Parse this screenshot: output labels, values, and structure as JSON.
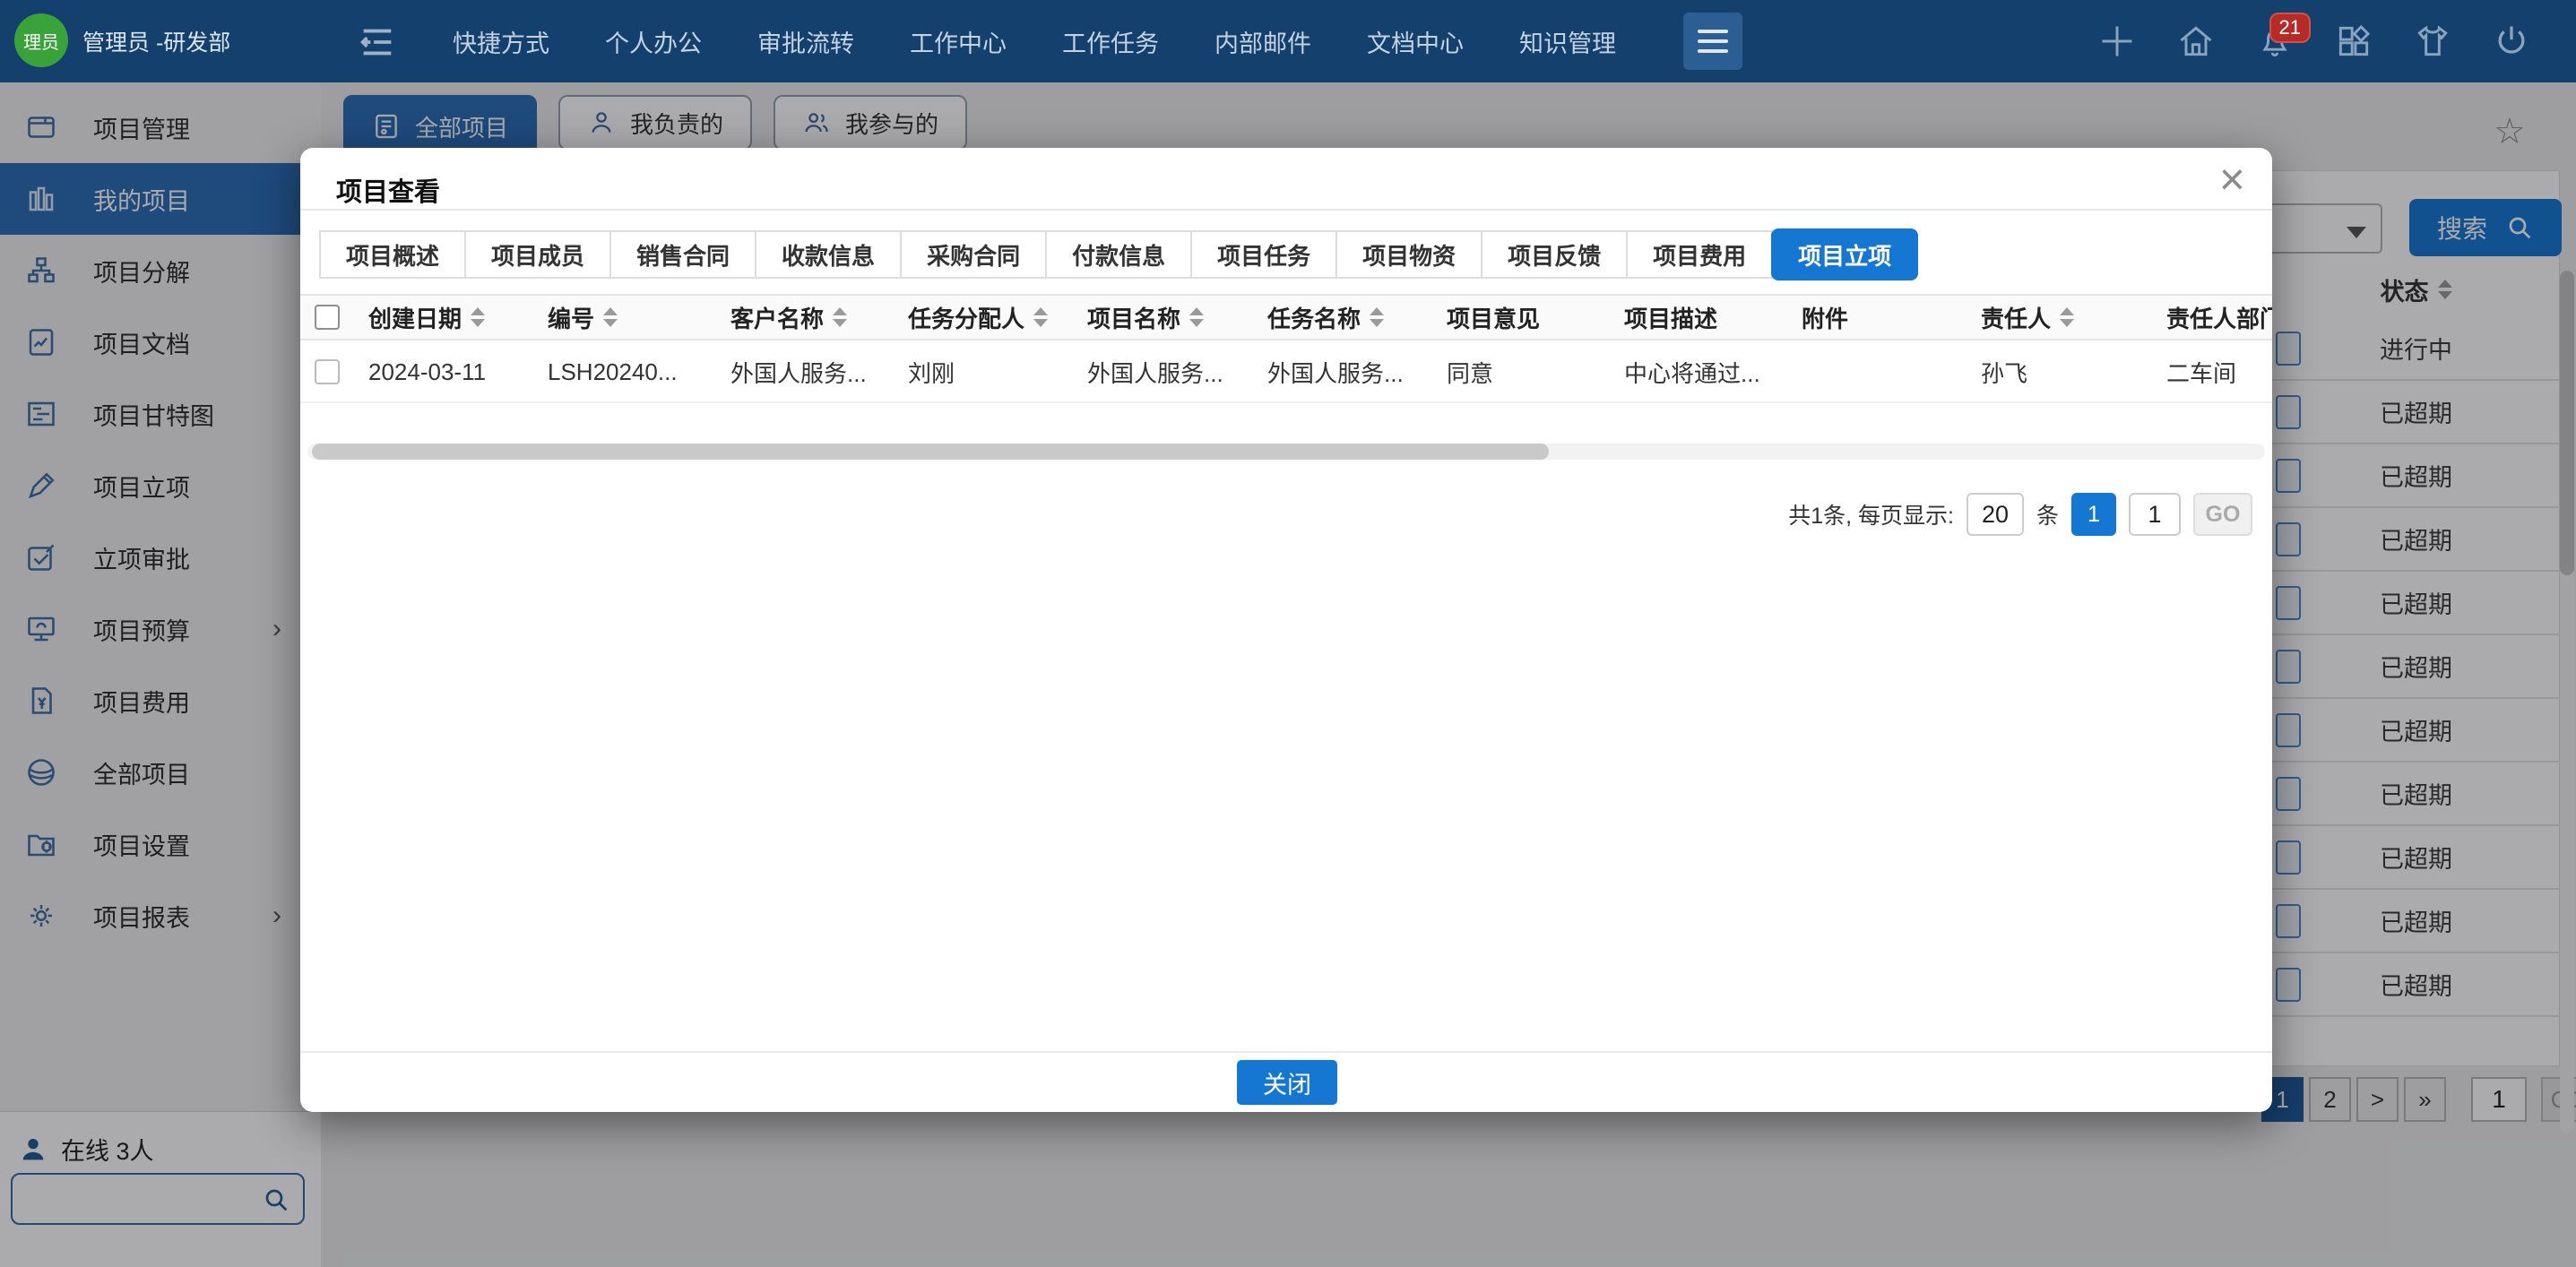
{
  "colors": {
    "accent": "#1677d2",
    "topbar": "#14406e",
    "active_nav": "#2a6cb5",
    "badge": "#b52b27",
    "avatar_green": "#3aa23a"
  },
  "topbar": {
    "user": {
      "avatar_text": "理员",
      "name": "管理员 -研发部"
    },
    "menu": [
      "快捷方式",
      "个人办公",
      "审批流转",
      "工作中心",
      "工作任务",
      "内部邮件",
      "文档中心",
      "知识管理"
    ],
    "notification_count": "21"
  },
  "sidebar": {
    "items": [
      {
        "label": "项目管理",
        "icon": "i-window",
        "active": false,
        "has_submenu": false
      },
      {
        "label": "我的项目",
        "icon": "i-myproj",
        "active": true,
        "has_submenu": false
      },
      {
        "label": "项目分解",
        "icon": "i-breakdown",
        "active": false,
        "has_submenu": false
      },
      {
        "label": "项目文档",
        "icon": "i-doc",
        "active": false,
        "has_submenu": false
      },
      {
        "label": "项目甘特图",
        "icon": "i-gantt",
        "active": false,
        "has_submenu": false
      },
      {
        "label": "项目立项",
        "icon": "i-pencil",
        "active": false,
        "has_submenu": false
      },
      {
        "label": "立项审批",
        "icon": "i-check",
        "active": false,
        "has_submenu": false
      },
      {
        "label": "项目预算",
        "icon": "i-monitor",
        "active": false,
        "has_submenu": true
      },
      {
        "label": "项目费用",
        "icon": "i-money",
        "active": false,
        "has_submenu": false
      },
      {
        "label": "全部项目",
        "icon": "i-layers",
        "active": false,
        "has_submenu": false
      },
      {
        "label": "项目设置",
        "icon": "i-folder",
        "active": false,
        "has_submenu": false
      },
      {
        "label": "项目报表",
        "icon": "i-gear",
        "active": false,
        "has_submenu": true
      }
    ],
    "online_label": "在线 3人"
  },
  "background": {
    "filters": [
      {
        "label": "全部项目",
        "icon": "i-listcard",
        "active": true
      },
      {
        "label": "我负责的",
        "icon": "i-person-o",
        "active": false
      },
      {
        "label": "我参与的",
        "icon": "i-people",
        "active": false
      }
    ],
    "search_button": "搜索",
    "table": {
      "status_header": "状态",
      "status_rows": [
        "进行中",
        "已超期",
        "已超期",
        "已超期",
        "已超期",
        "已超期",
        "已超期",
        "已超期",
        "已超期",
        "已超期",
        "已超期"
      ]
    },
    "pagination": {
      "pages": [
        {
          "label": "1",
          "active": true
        },
        {
          "label": "2",
          "active": false
        },
        {
          "label": ">",
          "active": false
        },
        {
          "label": "»",
          "active": false
        }
      ],
      "page_input": "1",
      "go": "GO"
    }
  },
  "modal": {
    "title": "项目查看",
    "close_icon": "×",
    "tabs": [
      {
        "label": "项目概述",
        "active": false
      },
      {
        "label": "项目成员",
        "active": false
      },
      {
        "label": "销售合同",
        "active": false
      },
      {
        "label": "收款信息",
        "active": false
      },
      {
        "label": "采购合同",
        "active": false
      },
      {
        "label": "付款信息",
        "active": false
      },
      {
        "label": "项目任务",
        "active": false
      },
      {
        "label": "项目物资",
        "active": false
      },
      {
        "label": "项目反馈",
        "active": false
      },
      {
        "label": "项目费用",
        "active": false
      },
      {
        "label": "项目立项",
        "active": true
      }
    ],
    "table": {
      "columns": [
        {
          "label": "创建日期",
          "sortable": true
        },
        {
          "label": "编号",
          "sortable": true
        },
        {
          "label": "客户名称",
          "sortable": true
        },
        {
          "label": "任务分配人",
          "sortable": true
        },
        {
          "label": "项目名称",
          "sortable": true
        },
        {
          "label": "任务名称",
          "sortable": true
        },
        {
          "label": "项目意见",
          "sortable": false
        },
        {
          "label": "项目描述",
          "sortable": false
        },
        {
          "label": "附件",
          "sortable": false
        },
        {
          "label": "责任人",
          "sortable": true
        },
        {
          "label": "责任人部门",
          "sortable": false
        }
      ],
      "row": [
        "2024-03-11",
        "LSH20240...",
        "外国人服务...",
        "刘刚",
        "外国人服务...",
        "外国人服务...",
        "同意",
        "中心将通过...",
        "",
        "孙飞",
        "二车间"
      ]
    },
    "pagination": {
      "summary": "共1条, 每页显示:",
      "page_size": "20",
      "unit": "条",
      "current_page": "1",
      "page_input": "1",
      "go": "GO"
    },
    "close_button": "关闭"
  }
}
